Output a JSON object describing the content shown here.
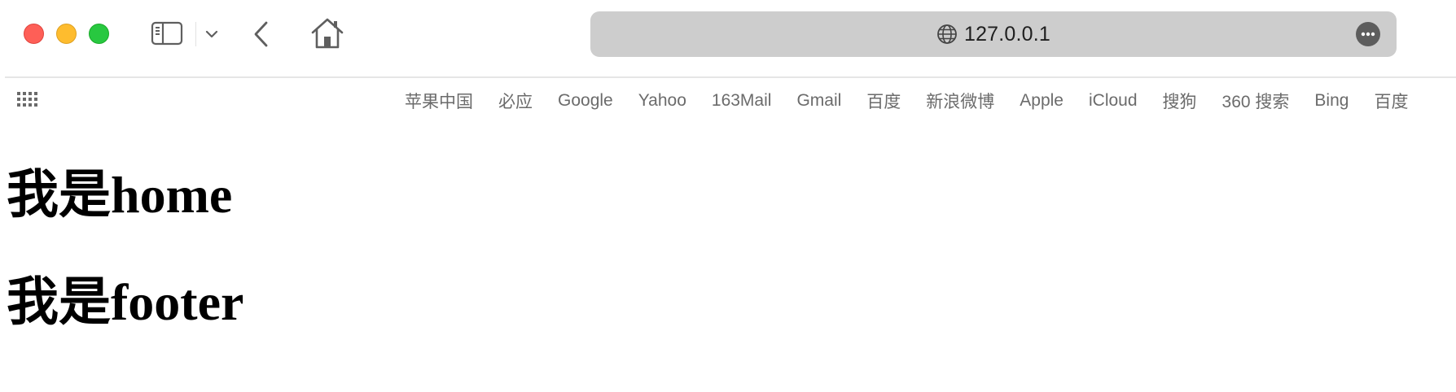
{
  "browser": {
    "address": "127.0.0.1",
    "icons": {
      "close": "close-traffic-light",
      "minimize": "minimize-traffic-light",
      "zoom": "zoom-traffic-light",
      "sidebar": "sidebar-icon",
      "chevron": "chevron-down-icon",
      "back": "back-arrow-icon",
      "home": "home-icon",
      "globe": "globe-icon",
      "more": "more-icon",
      "apps": "grid-icon"
    },
    "colors": {
      "close": "#fe5f57",
      "minimize": "#febc2e",
      "zoom": "#28c840",
      "address_bar": "#cdcdcd"
    }
  },
  "favorites": [
    "苹果中国",
    "必应",
    "Google",
    "Yahoo",
    "163Mail",
    "Gmail",
    "百度",
    "新浪微博",
    "Apple",
    "iCloud",
    "搜狗",
    "360 搜索",
    "Bing",
    "百度"
  ],
  "page": {
    "heading_home": "我是home",
    "heading_footer": "我是footer"
  }
}
